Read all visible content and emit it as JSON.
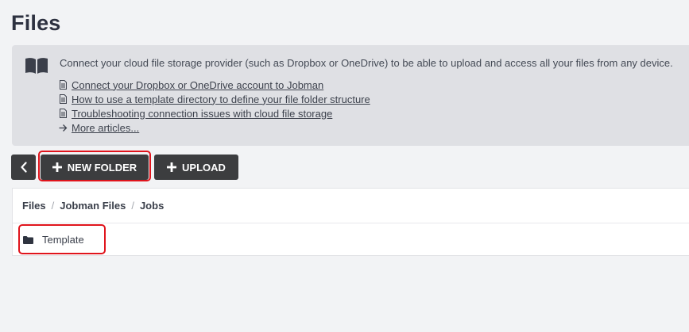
{
  "page": {
    "title": "Files"
  },
  "info": {
    "icon": "book-icon",
    "intro": "Connect your cloud file storage provider (such as Dropbox or OneDrive) to be able to upload and access all your files from any device.",
    "articles": [
      {
        "icon": "document-icon",
        "label": "Connect your Dropbox or OneDrive account to Jobman"
      },
      {
        "icon": "document-icon",
        "label": "How to use a template directory to define your file folder structure"
      },
      {
        "icon": "document-icon",
        "label": "Troubleshooting connection issues with cloud file storage"
      }
    ],
    "more": {
      "icon": "arrow-right-icon",
      "label": "More articles..."
    }
  },
  "toolbar": {
    "back_icon": "chevron-left-icon",
    "new_folder_label": "NEW FOLDER",
    "new_folder_icon": "plus-icon",
    "upload_label": "UPLOAD",
    "upload_icon": "plus-icon"
  },
  "breadcrumb": {
    "items": [
      "Files",
      "Jobman Files",
      "Jobs"
    ],
    "separator": "/"
  },
  "files": [
    {
      "type": "folder",
      "icon": "folder-icon",
      "name": "Template"
    }
  ],
  "colors": {
    "background": "#f2f3f5",
    "info_panel": "#dfe0e4",
    "button": "#3c3d3f",
    "highlight": "#e0141c"
  }
}
